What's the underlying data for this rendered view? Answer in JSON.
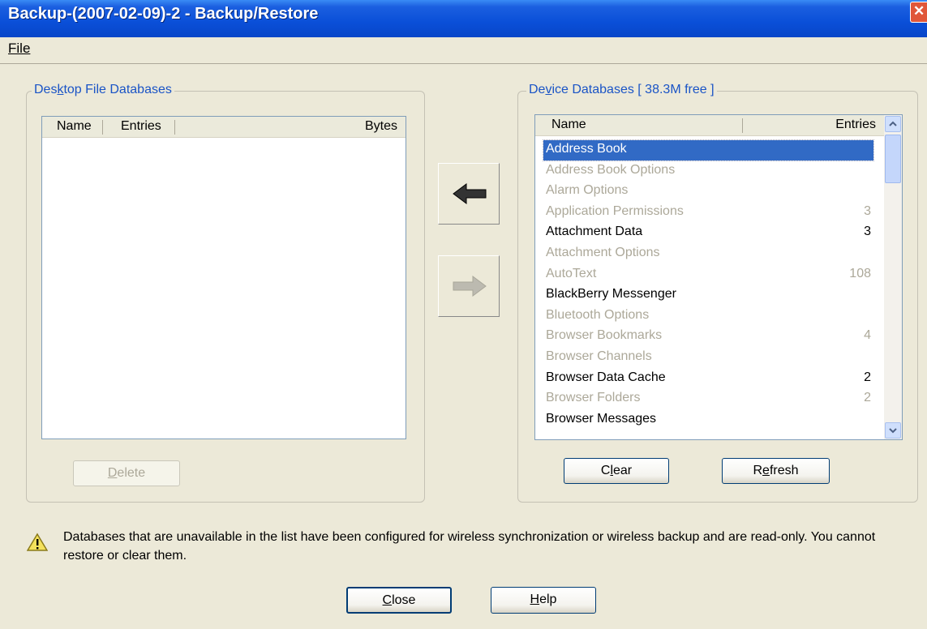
{
  "window": {
    "title": "Backup-(2007-02-09)-2 - Backup/Restore"
  },
  "menu": {
    "file": "File"
  },
  "desktop": {
    "title_prefix": "Des",
    "title_key": "k",
    "title_suffix": "top File Databases",
    "columns": [
      "Name",
      "Entries",
      "Bytes"
    ],
    "delete_key": "D",
    "delete_rest": "elete"
  },
  "device": {
    "title_pre": "De",
    "title_key": "v",
    "title_suffix": "ice Databases  [ 38.3M free ]",
    "columns": [
      "Name",
      "Entries"
    ],
    "rows": [
      {
        "name": "Address Book",
        "entries": ""
      },
      {
        "name": "Address Book Options",
        "entries": ""
      },
      {
        "name": "Alarm Options",
        "entries": ""
      },
      {
        "name": "Application Permissions",
        "entries": "3"
      },
      {
        "name": "Attachment Data",
        "entries": "3"
      },
      {
        "name": "Attachment Options",
        "entries": ""
      },
      {
        "name": "AutoText",
        "entries": "108"
      },
      {
        "name": "BlackBerry Messenger",
        "entries": ""
      },
      {
        "name": "Bluetooth Options",
        "entries": ""
      },
      {
        "name": "Browser Bookmarks",
        "entries": "4"
      },
      {
        "name": "Browser Channels",
        "entries": ""
      },
      {
        "name": "Browser Data Cache",
        "entries": "2"
      },
      {
        "name": "Browser Folders",
        "entries": "2"
      },
      {
        "name": "Browser Messages",
        "entries": ""
      }
    ],
    "clear_key": "l",
    "clear_pre": "C",
    "clear_post": "ear",
    "refresh_pre": "R",
    "refresh_key": "e",
    "refresh_post": "fresh"
  },
  "note": "Databases that are unavailable in the list have been configured for wireless synchronization or wireless backup and are read-only. You cannot restore or clear them.",
  "footer": {
    "close_key": "C",
    "close_rest": "lose",
    "help_key": "H",
    "help_rest": "elp"
  }
}
